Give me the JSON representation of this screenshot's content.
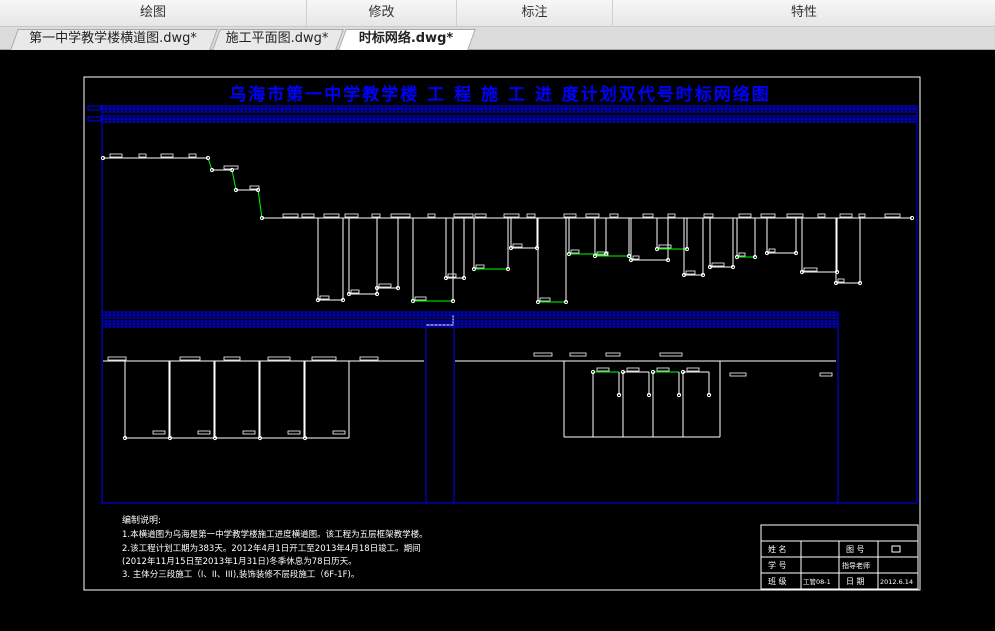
{
  "ribbon": {
    "groups": [
      "绘图",
      "修改",
      "标注",
      "特性"
    ]
  },
  "tabs": [
    {
      "label": "第一中学教学楼横道图.dwg*",
      "active": false
    },
    {
      "label": "施工平面图.dwg*",
      "active": false
    },
    {
      "label": "时标网络.dwg*",
      "active": true
    }
  ],
  "drawing": {
    "title": "乌海市第一中学教学楼 工 程 施 工 进 度计划双代号时标网络图",
    "notes": {
      "heading": "编制说明:",
      "lines": [
        "1.本横道图为乌海是第一中学教学楼施工进度横道图。该工程为五层框架教学楼。",
        "2.该工程计划工期为383天。2012年4月1日开工至2013年4月18日竣工。期间",
        "(2012年11月15日至2013年1月31日)冬季休息为78日历天。",
        "3. 主体分三段施工（I、II、III),装饰装修不层段施工（6F-1F)。"
      ]
    },
    "titleblock": {
      "name_label": "姓 名",
      "id_label": "学 号",
      "class_label": "班 级",
      "class_value": "工管08-1",
      "drawing_no_label": "图 号",
      "advisor_label": "指导老师",
      "date_label": "日 期",
      "date_value": "2012.6.14"
    }
  },
  "colors": {
    "background": "#000000",
    "frame": "#ffffff",
    "title": "#0000ff",
    "grid": "#0000ff",
    "network": "#ffffff",
    "critical": "#00ff00"
  }
}
